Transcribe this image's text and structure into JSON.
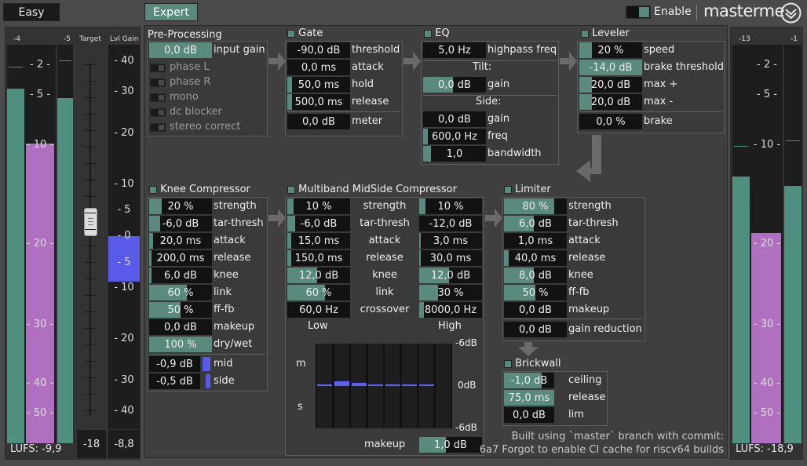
{
  "top": {
    "easy": "Easy",
    "expert": "Expert",
    "enable": "Enable",
    "brand": "masterme"
  },
  "colors": {
    "accent": "#5a8a7e",
    "meter_teal": "#4f8f7f",
    "meter_purple": "#b070c0",
    "target_blue": "#5a5ae8"
  },
  "left_meter": {
    "label_l": "-4",
    "label_r": "-5",
    "target_label": "Target",
    "lvlgain_label": "Lvl Gain",
    "scale": [
      "2",
      "5",
      "10",
      "20",
      "30",
      "40",
      "50"
    ],
    "lufs": "LUFS: -9,9",
    "target_value": "-18",
    "lvlgain_value": "-8,8",
    "gain_scale": [
      "40",
      "30",
      "20",
      "10",
      "5",
      "0",
      "5",
      "10",
      "20",
      "30",
      "40"
    ]
  },
  "right_meter": {
    "label_l": "-13",
    "label_r": "-1",
    "scale": [
      "2",
      "5",
      "10",
      "20",
      "30",
      "40",
      "50"
    ],
    "lufs": "LUFS: -18,9"
  },
  "preprocessing": {
    "title": "Pre-Processing",
    "input_gain": "0,0 dB",
    "input_gain_label": "input gain",
    "options": [
      "phase L",
      "phase R",
      "mono",
      "dc blocker",
      "stereo correct"
    ]
  },
  "gate": {
    "title": "Gate",
    "rows": [
      {
        "v": "-90,0 dB",
        "l": "threshold"
      },
      {
        "v": "0,0 ms",
        "l": "attack"
      },
      {
        "v": "50,0 ms",
        "l": "hold"
      },
      {
        "v": "500,0 ms",
        "l": "release"
      }
    ],
    "meter": {
      "v": "0,0 dB",
      "l": "meter"
    }
  },
  "eq": {
    "title": "EQ",
    "highpass": {
      "v": "5,0 Hz",
      "l": "highpass freq"
    },
    "tilt_label": "Tilt:",
    "tilt_gain": {
      "v": "0,0 dB",
      "l": "gain"
    },
    "side_label": "Side:",
    "side": [
      {
        "v": "0,0 dB",
        "l": "gain"
      },
      {
        "v": "600,0 Hz",
        "l": "freq"
      },
      {
        "v": "1,0",
        "l": "bandwidth"
      }
    ]
  },
  "leveler": {
    "title": "Leveler",
    "rows": [
      {
        "v": "20 %",
        "l": "speed"
      },
      {
        "v": "-14,0 dB",
        "l": "brake threshold"
      },
      {
        "v": "20,0 dB",
        "l": "max +"
      },
      {
        "v": "20,0 dB",
        "l": "max -"
      }
    ],
    "brake": {
      "v": "0,0 %",
      "l": "brake"
    }
  },
  "knee": {
    "title": "Knee Compressor",
    "rows": [
      {
        "v": "20 %",
        "l": "strength"
      },
      {
        "v": "-6,0 dB",
        "l": "tar-thresh"
      },
      {
        "v": "20,0 ms",
        "l": "attack"
      },
      {
        "v": "200,0 ms",
        "l": "release"
      },
      {
        "v": "6,0 dB",
        "l": "knee"
      },
      {
        "v": "60 %",
        "l": "link"
      },
      {
        "v": "50 %",
        "l": "ff-fb"
      },
      {
        "v": "0,0 dB",
        "l": "makeup"
      },
      {
        "v": "100 %",
        "l": "dry/wet"
      }
    ],
    "mid": {
      "v": "-0,9 dB",
      "l": "mid"
    },
    "side": {
      "v": "-0,5 dB",
      "l": "side"
    }
  },
  "multiband": {
    "title": "Multiband MidSide Compressor",
    "labels": [
      "strength",
      "tar-thresh",
      "attack",
      "release",
      "knee",
      "link",
      "crossover"
    ],
    "low": [
      "10 %",
      "-6,0 dB",
      "15,0 ms",
      "150,0 ms",
      "12,0 dB",
      "60 %",
      "60,0 Hz"
    ],
    "high": [
      "10 %",
      "-12,0 dB",
      "3,0 ms",
      "30,0 ms",
      "12,0 dB",
      "30 %",
      "8000,0 Hz"
    ],
    "low_label": "Low",
    "high_label": "High",
    "m_label": "m",
    "s_label": "s",
    "db_top": "-6dB",
    "db_mid": "0dB",
    "db_bot": "-6dB",
    "makeup": {
      "v": "1,0 dB",
      "l": "makeup"
    }
  },
  "limiter": {
    "title": "Limiter",
    "rows": [
      {
        "v": "80 %",
        "l": "strength"
      },
      {
        "v": "6,0 dB",
        "l": "tar-thresh"
      },
      {
        "v": "1,0 ms",
        "l": "attack"
      },
      {
        "v": "40,0 ms",
        "l": "release"
      },
      {
        "v": "8,0 dB",
        "l": "knee"
      },
      {
        "v": "50 %",
        "l": "ff-fb"
      },
      {
        "v": "0,0 dB",
        "l": "makeup"
      }
    ],
    "gr": {
      "v": "0,0 dB",
      "l": "gain reduction"
    }
  },
  "brickwall": {
    "title": "Brickwall",
    "rows": [
      {
        "v": "-1,0 dB",
        "l": "ceiling"
      },
      {
        "v": "75,0 ms",
        "l": "release"
      },
      {
        "v": "0,0 dB",
        "l": "lim"
      }
    ]
  },
  "footer": {
    "line1": "Built using `master` branch with commit:",
    "line2": "6a7 Forgot to enable CI cache for riscv64 builds"
  }
}
